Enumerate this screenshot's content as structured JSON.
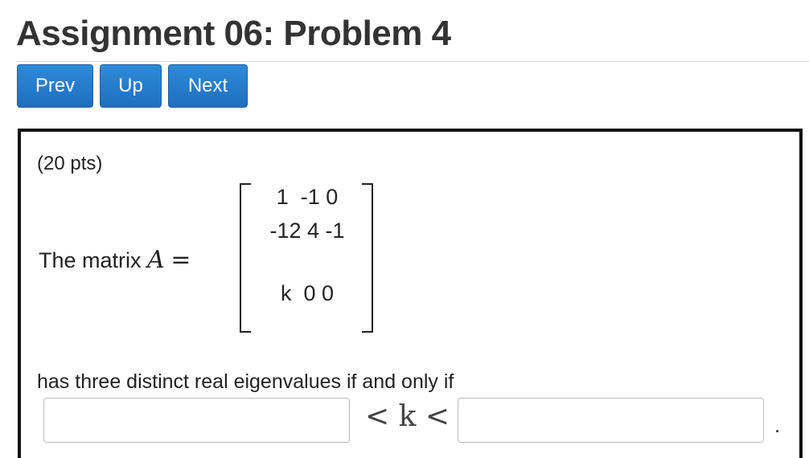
{
  "page": {
    "title": "Assignment 06: Problem 4"
  },
  "nav": {
    "prev_label": "Prev",
    "up_label": "Up",
    "next_label": "Next"
  },
  "problem": {
    "points": "(20 pts)",
    "matrix_intro": "The matrix",
    "matrix_symbol": "A",
    "equals": "=",
    "matrix_rows": [
      "1  -1 0",
      "-12 4 -1",
      "k  0 0"
    ],
    "question": "has three distinct real eigenvalues if and only if",
    "inequality": "< k <",
    "lower_bound_value": "",
    "upper_bound_value": "",
    "end_punctuation": "."
  },
  "colors": {
    "button_primary": "#1f6fc0",
    "title_text": "#333333",
    "box_border": "#111111"
  }
}
